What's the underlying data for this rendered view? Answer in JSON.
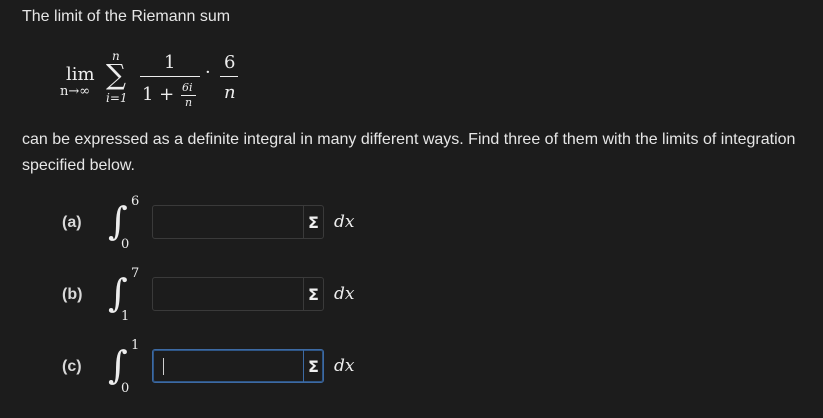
{
  "intro_text": "The limit of the Riemann sum",
  "formula": {
    "lim": "lim",
    "lim_sub": "n→∞",
    "sigma": "∑",
    "sum_upper": "n",
    "sum_lower": "i=1",
    "numerator": "1",
    "denom_one_plus": "1 +",
    "inner_num": "6i",
    "inner_den": "n",
    "dot": "·",
    "factor_num": "6",
    "factor_den": "n"
  },
  "description": "can be expressed as a definite integral in many different ways. Find three of them with the limits of integration specified below.",
  "integral_symbol": "∫",
  "parts": [
    {
      "label": "(a)",
      "upper": "6",
      "lower": "0",
      "value": "",
      "dx": "dx",
      "sigma": "Σ"
    },
    {
      "label": "(b)",
      "upper": "7",
      "lower": "1",
      "value": "",
      "dx": "dx",
      "sigma": "Σ"
    },
    {
      "label": "(c)",
      "upper": "1",
      "lower": "0",
      "value": "",
      "dx": "dx",
      "sigma": "Σ"
    }
  ],
  "colors": {
    "background": "#1c1c1c",
    "text": "#e6e6e6",
    "focus_border": "#3d6aa3",
    "input_border": "#3a3a3a"
  }
}
